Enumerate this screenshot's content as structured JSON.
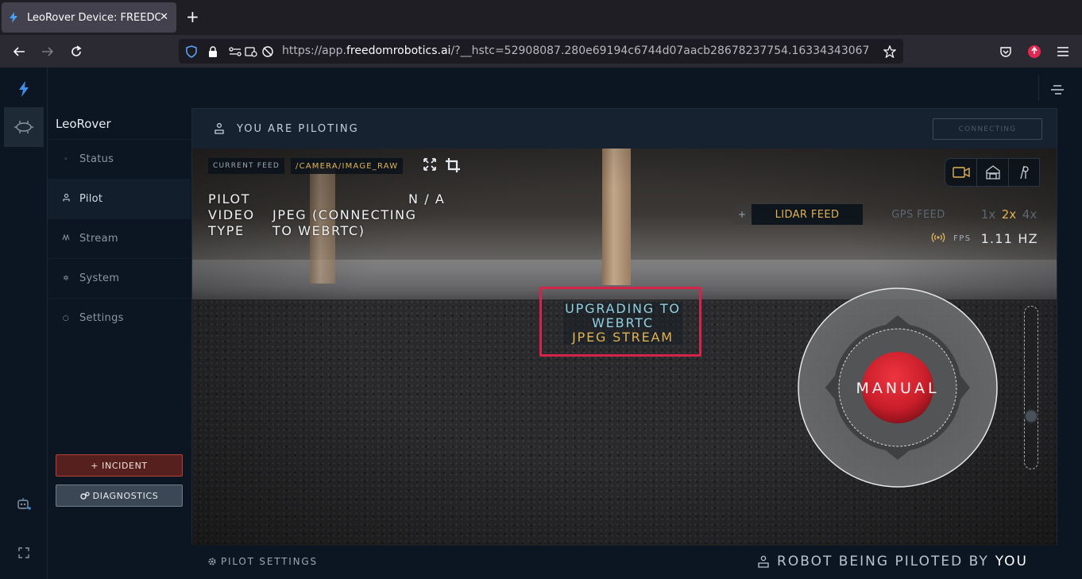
{
  "browser": {
    "tab_title": "LeoRover Device: FREEDOM",
    "new_tab": "+",
    "url_prefix": "https://app.",
    "url_domain": "freedomrobotics.ai",
    "url_rest": "/?__hstc=52908087.280e69194c6744d07aacb28678237754.16334343067"
  },
  "sidebar": {
    "robot_name": "LeoRover",
    "items": [
      {
        "label": "Status",
        "icon": "circle-icon"
      },
      {
        "label": "Pilot",
        "icon": "person-icon"
      },
      {
        "label": "Stream",
        "icon": "stream-icon"
      },
      {
        "label": "System",
        "icon": "gear-icon"
      },
      {
        "label": "Settings",
        "icon": "settings-icon"
      }
    ],
    "incident_label": "+ INCIDENT",
    "diagnostics_label": "DIAGNOSTICS"
  },
  "panel": {
    "piloting_label": "YOU ARE PILOTING",
    "connecting_label": "CONNECTING",
    "current_feed_label": "CURRENT FEED",
    "current_feed_value": "/CAMERA/IMAGE_RAW",
    "info": {
      "pilot_key": "PILOT",
      "pilot_value": "N / A",
      "video_key": "VIDEO",
      "video_value_1": "JPEG (CONNECTING",
      "type_key": "TYPE",
      "video_value_2": "TO WEBRTC)"
    },
    "upgrade_line_1": "UPGRADING TO",
    "upgrade_line_2": "WEBRTC",
    "upgrade_line_3": "JPEG STREAM",
    "lidar_plus": "+",
    "lidar_label": "LIDAR FEED",
    "gps_label": "GPS FEED",
    "zoom_levels": [
      "1x",
      "2x",
      "4x"
    ],
    "fps_label": "FPS",
    "fps_value": "1.11 HZ",
    "joystick_label": "MANUAL"
  },
  "footer": {
    "pilot_settings": "PILOT SETTINGS",
    "piloted_by": "ROBOT BEING PILOTED BY",
    "piloted_you": "YOU"
  },
  "colors": {
    "accent": "#e0b356",
    "highlight": "#d6234a",
    "joystick_red": "#c81e2a"
  }
}
